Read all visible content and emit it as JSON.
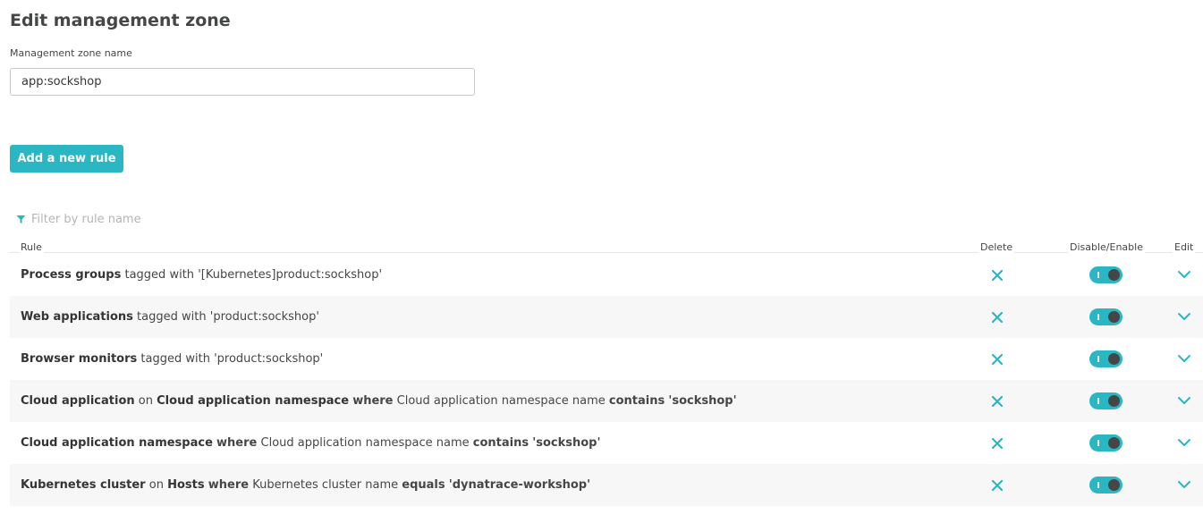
{
  "title": "Edit management zone",
  "zone_name_label": "Management zone name",
  "zone_name_value": "app:sockshop",
  "add_rule_label": "Add a new rule",
  "filter_placeholder": "Filter by rule name",
  "columns": {
    "rule": "Rule",
    "delete": "Delete",
    "toggle": "Disable/Enable",
    "edit": "Edit"
  },
  "colors": {
    "accent": "#2ab6c3",
    "text": "#454646"
  },
  "rules": [
    {
      "entity": "Process groups",
      "r1": "tagged",
      "r2": "with",
      "r3": "'[Kubernetes]product:sockshop'",
      "enabled": true
    },
    {
      "entity": "Web applications",
      "r1": "tagged",
      "r2": "with",
      "r3": "'product:sockshop'",
      "enabled": true
    },
    {
      "entity": "Browser monitors",
      "r1": "tagged",
      "r2": "with",
      "r3": "'product:sockshop'",
      "enabled": true
    },
    {
      "entity": "Cloud application",
      "r1": "on",
      "r2": "Cloud application namespace",
      "r3": "where",
      "r4": "Cloud application namespace name",
      "r5": "contains",
      "r6": "'sockshop'",
      "enabled": true
    },
    {
      "entity": "Cloud application namespace",
      "r1": "where",
      "r2": "Cloud application namespace name",
      "r3": "contains",
      "r4": "'sockshop'",
      "enabled": true
    },
    {
      "entity": "Kubernetes cluster",
      "r1": "on",
      "r2": "Hosts",
      "r3": "where",
      "r4": "Kubernetes cluster name",
      "r5": "equals",
      "r6": "'dynatrace-workshop'",
      "enabled": true
    }
  ],
  "icons": {
    "filter": "filter-icon",
    "delete": "close-icon",
    "edit": "chevron-down-icon"
  }
}
